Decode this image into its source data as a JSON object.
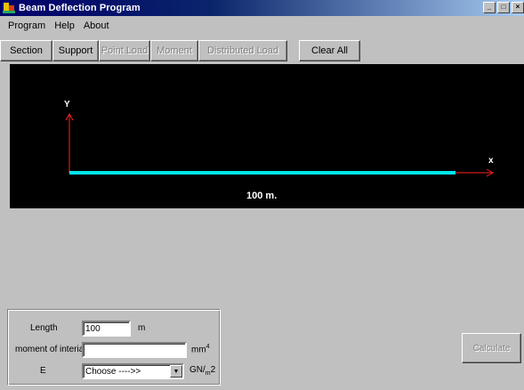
{
  "window": {
    "title": "Beam Deflection Program"
  },
  "menu": [
    "Program",
    "Help",
    "About"
  ],
  "toolbar": {
    "buttons": [
      {
        "label": "Section",
        "enabled": true
      },
      {
        "label": "Support",
        "enabled": true
      },
      {
        "label": "Point Load",
        "enabled": false
      },
      {
        "label": "Moment",
        "enabled": false
      },
      {
        "label": "Distributed Load",
        "enabled": false
      }
    ],
    "clear_label": "Clear All"
  },
  "canvas": {
    "y_axis_label": "Y",
    "x_axis_label": "x",
    "beam_length_label": "100 m.",
    "colors": {
      "background": "#000000",
      "beam": "#00e5ee",
      "axes": "#ff2020"
    }
  },
  "inputs": {
    "length_label": "Length",
    "length_value": "100",
    "length_unit": "m",
    "moi_label": "moment of interia",
    "moi_value": "",
    "moi_unit_base": "mm",
    "moi_unit_exp": "4",
    "e_label": "E",
    "e_selected": "Choose ---->>",
    "e_unit_main": "GN/",
    "e_unit_sub": "m",
    "e_unit_tail": "2"
  },
  "calculate_label": "Calculate"
}
